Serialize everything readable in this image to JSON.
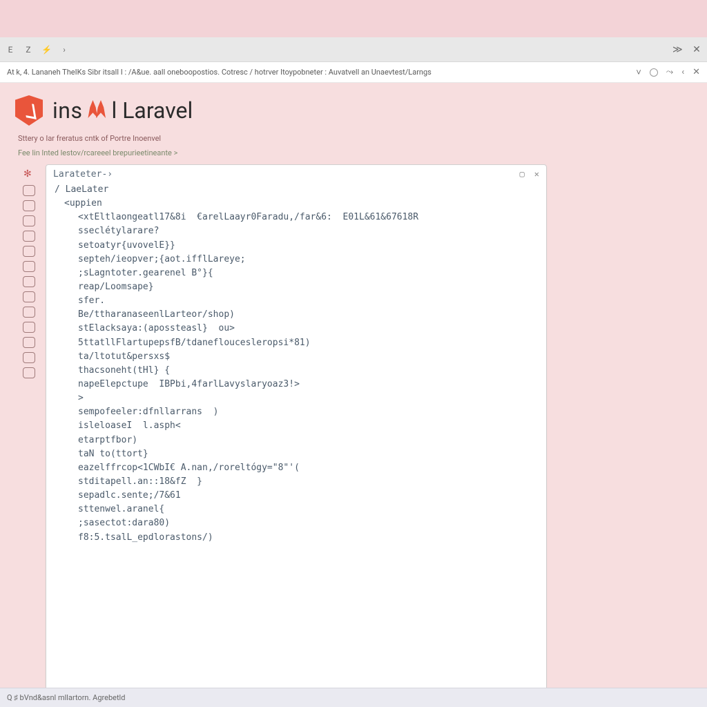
{
  "tab_bar": {
    "left_glyphs": [
      "E",
      "Z",
      "⚡",
      "›"
    ],
    "right_glyphs": [
      "≫",
      "✕"
    ]
  },
  "address_bar": {
    "text": "At  k,  4.  Lananeh TheIKs Sibr itsall I : /A&ue. aall oneboopostios.  Cotresc / hotrver  Itoypobneter :  Auvatvell an Unaevtest/Larngs",
    "right_glyphs": [
      "˅",
      "○",
      "⤳",
      "‹",
      "✕"
    ]
  },
  "page": {
    "title_left": "ins",
    "title_right": "l Laravel",
    "intro": "Sttery o Iar freratus cntk of Portre Inoenvel",
    "breadcrumb": "Fee lin lnted lestov/rcareeel brepurieetineante  >"
  },
  "editor": {
    "prompt": "Larateter-›",
    "window_controls": [
      "▢",
      "✕"
    ],
    "lines": [
      "/ LaeLater",
      "<uppien",
      "<xtEltlaongeatl17&8i  €arelLaayr0Faradu,/far&6:  E01L&61&67618R",
      "sseclétylarare?",
      "setoatyr{uvovelE}}",
      "septeh/ieopver;{aot.ifflLareye;",
      ";sLagntoter.gearenel B°}{",
      "reap/Loomsape}",
      "sfer.",
      "Be/ttharanaseenlLarteor/shop)",
      "stElacksaya:(apossteasl}  ou>",
      "5ttatllFlartupepsfB/tdanefloucesleropsi*81)",
      "ta/ltotut&persxs$",
      "thacsoneht(tHl} {",
      "napeElepctupe  IBPbi,4farlLavyslaryoaz3!>",
      ">",
      "sempofeeler:dfnllarrans  )",
      "isleloaseI  l.asph<",
      "etarptfbor)",
      "taN to(ttort}",
      "eazelffrcop<1CWbI€ A.nan,/roreltógy=\"8\"'(",
      "stditapell.an::18&fZ  }",
      "sepadlc.sente;/7&61",
      "sttenwel.aranel{",
      ";sasectot:dara80)",
      "f8:5.tsalL_epdlorastons/)"
    ]
  },
  "status_bar": {
    "text": "Q ♯ bVnd&asnl mllartorn. Agrebetld"
  },
  "rail_icons": [
    "star",
    "box",
    "box",
    "box",
    "box",
    "box",
    "box",
    "box",
    "box",
    "box",
    "box",
    "box",
    "box",
    "box"
  ]
}
